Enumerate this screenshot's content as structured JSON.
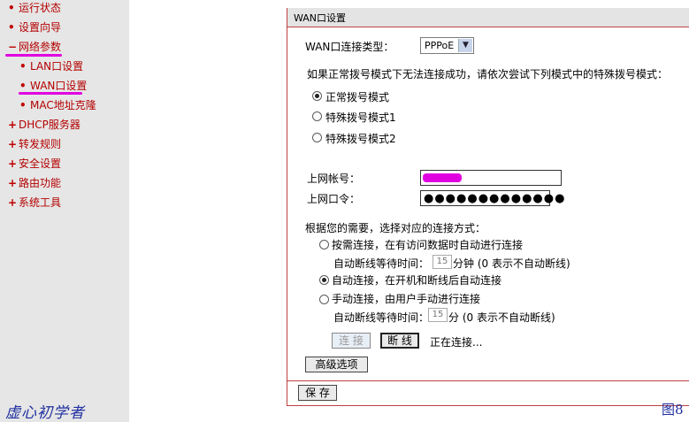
{
  "sidebar": {
    "items": [
      {
        "marker": "•",
        "label": "运行状态"
      },
      {
        "marker": "•",
        "label": "设置向导"
      },
      {
        "marker": "−",
        "label": "网络参数"
      },
      {
        "marker": "•",
        "label": "LAN口设置"
      },
      {
        "marker": "•",
        "label": "WAN口设置"
      },
      {
        "marker": "•",
        "label": "MAC地址克隆"
      },
      {
        "marker": "+",
        "label": "DHCP服务器"
      },
      {
        "marker": "+",
        "label": "转发规则"
      },
      {
        "marker": "+",
        "label": "安全设置"
      },
      {
        "marker": "+",
        "label": "路由功能"
      },
      {
        "marker": "+",
        "label": "系统工具"
      }
    ],
    "watermark": "虚心初学者",
    "highlight_color": "#e000e0"
  },
  "panel": {
    "title": "WAN口设置",
    "conn_type_label": "WAN口连接类型：",
    "conn_type_value": "PPPoE",
    "dial_hint": "如果正常拨号模式下无法连接成功，请依次尝试下列模式中的特殊拨号模式：",
    "dial_modes": [
      {
        "label": "正常拨号模式",
        "selected": true
      },
      {
        "label": "特殊拨号模式1",
        "selected": false
      },
      {
        "label": "特殊拨号模式2",
        "selected": false
      }
    ],
    "account_label": "上网帐号：",
    "password_label": "上网口令：",
    "password_mask": "●●●●●●●●●●●●●",
    "conn_mode_label": "根据您的需要，选择对应的连接方式：",
    "conn_modes": [
      {
        "label": "按需连接，在有访问数据时自动进行连接",
        "selected": false
      },
      {
        "label": "自动连接，在开机和断线后自动连接",
        "selected": true
      },
      {
        "label": "手动连接，由用户手动进行连接",
        "selected": false
      }
    ],
    "idle1_label": "自动断线等待时间：",
    "idle1_value": "15",
    "idle1_unit": "分钟  (0 表示不自动断线)",
    "idle2_label": "自动断线等待时间：",
    "idle2_value": "15",
    "idle2_unit": "分  (0 表示不自动断线)",
    "connect_button": "连 接",
    "disconnect_button": "断 线",
    "status_text": "正在连接...",
    "advanced_button": "高级选项",
    "save_button": "保 存"
  },
  "figure_label": "图8"
}
